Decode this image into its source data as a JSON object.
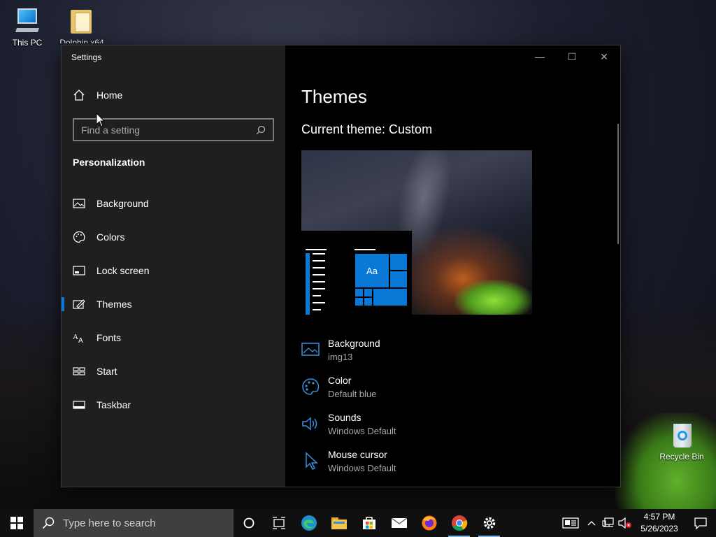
{
  "desktop": {
    "icons": [
      {
        "label": "This PC"
      },
      {
        "label": "Dolphin x64"
      },
      {
        "label": "Recycle Bin"
      }
    ]
  },
  "window": {
    "title": "Settings",
    "home_label": "Home",
    "search_placeholder": "Find a setting",
    "section_title": "Personalization",
    "nav": [
      {
        "label": "Background",
        "icon": "image-icon"
      },
      {
        "label": "Colors",
        "icon": "palette-icon"
      },
      {
        "label": "Lock screen",
        "icon": "lock-screen-icon"
      },
      {
        "label": "Themes",
        "icon": "themes-icon",
        "active": true
      },
      {
        "label": "Fonts",
        "icon": "fonts-icon"
      },
      {
        "label": "Start",
        "icon": "start-icon"
      },
      {
        "label": "Taskbar",
        "icon": "taskbar-icon"
      }
    ],
    "caption": {
      "minimize": "—",
      "maximize": "☐",
      "close": "✕"
    }
  },
  "content": {
    "title": "Themes",
    "current_theme": "Current theme: Custom",
    "preview_tile_text": "Aa",
    "items": [
      {
        "label": "Background",
        "value": "img13",
        "icon": "image-icon"
      },
      {
        "label": "Color",
        "value": "Default blue",
        "icon": "palette-icon"
      },
      {
        "label": "Sounds",
        "value": "Windows Default",
        "icon": "speaker-icon"
      },
      {
        "label": "Mouse cursor",
        "value": "Windows Default",
        "icon": "cursor-icon"
      }
    ]
  },
  "taskbar": {
    "search_placeholder": "Type here to search",
    "apps": [
      "cortana-icon",
      "task-view-icon",
      "edge-icon",
      "file-explorer-icon",
      "store-icon",
      "mail-icon",
      "firefox-icon",
      "chrome-icon",
      "settings-icon"
    ],
    "time": "4:57 PM",
    "date": "5/26/2023"
  },
  "colors": {
    "accent": "#0a78d7"
  }
}
